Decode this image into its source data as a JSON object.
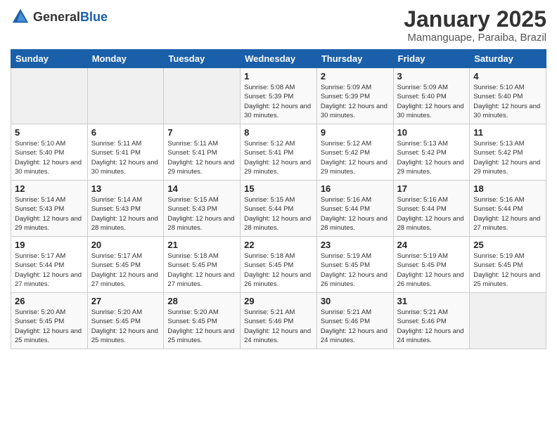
{
  "logo": {
    "general": "General",
    "blue": "Blue"
  },
  "title": {
    "month_year": "January 2025",
    "location": "Mamanguape, Paraiba, Brazil"
  },
  "days_of_week": [
    "Sunday",
    "Monday",
    "Tuesday",
    "Wednesday",
    "Thursday",
    "Friday",
    "Saturday"
  ],
  "weeks": [
    [
      {
        "num": "",
        "sunrise": "",
        "sunset": "",
        "daylight": ""
      },
      {
        "num": "",
        "sunrise": "",
        "sunset": "",
        "daylight": ""
      },
      {
        "num": "",
        "sunrise": "",
        "sunset": "",
        "daylight": ""
      },
      {
        "num": "1",
        "sunrise": "Sunrise: 5:08 AM",
        "sunset": "Sunset: 5:39 PM",
        "daylight": "Daylight: 12 hours and 30 minutes."
      },
      {
        "num": "2",
        "sunrise": "Sunrise: 5:09 AM",
        "sunset": "Sunset: 5:39 PM",
        "daylight": "Daylight: 12 hours and 30 minutes."
      },
      {
        "num": "3",
        "sunrise": "Sunrise: 5:09 AM",
        "sunset": "Sunset: 5:40 PM",
        "daylight": "Daylight: 12 hours and 30 minutes."
      },
      {
        "num": "4",
        "sunrise": "Sunrise: 5:10 AM",
        "sunset": "Sunset: 5:40 PM",
        "daylight": "Daylight: 12 hours and 30 minutes."
      }
    ],
    [
      {
        "num": "5",
        "sunrise": "Sunrise: 5:10 AM",
        "sunset": "Sunset: 5:40 PM",
        "daylight": "Daylight: 12 hours and 30 minutes."
      },
      {
        "num": "6",
        "sunrise": "Sunrise: 5:11 AM",
        "sunset": "Sunset: 5:41 PM",
        "daylight": "Daylight: 12 hours and 30 minutes."
      },
      {
        "num": "7",
        "sunrise": "Sunrise: 5:11 AM",
        "sunset": "Sunset: 5:41 PM",
        "daylight": "Daylight: 12 hours and 29 minutes."
      },
      {
        "num": "8",
        "sunrise": "Sunrise: 5:12 AM",
        "sunset": "Sunset: 5:41 PM",
        "daylight": "Daylight: 12 hours and 29 minutes."
      },
      {
        "num": "9",
        "sunrise": "Sunrise: 5:12 AM",
        "sunset": "Sunset: 5:42 PM",
        "daylight": "Daylight: 12 hours and 29 minutes."
      },
      {
        "num": "10",
        "sunrise": "Sunrise: 5:13 AM",
        "sunset": "Sunset: 5:42 PM",
        "daylight": "Daylight: 12 hours and 29 minutes."
      },
      {
        "num": "11",
        "sunrise": "Sunrise: 5:13 AM",
        "sunset": "Sunset: 5:42 PM",
        "daylight": "Daylight: 12 hours and 29 minutes."
      }
    ],
    [
      {
        "num": "12",
        "sunrise": "Sunrise: 5:14 AM",
        "sunset": "Sunset: 5:43 PM",
        "daylight": "Daylight: 12 hours and 29 minutes."
      },
      {
        "num": "13",
        "sunrise": "Sunrise: 5:14 AM",
        "sunset": "Sunset: 5:43 PM",
        "daylight": "Daylight: 12 hours and 28 minutes."
      },
      {
        "num": "14",
        "sunrise": "Sunrise: 5:15 AM",
        "sunset": "Sunset: 5:43 PM",
        "daylight": "Daylight: 12 hours and 28 minutes."
      },
      {
        "num": "15",
        "sunrise": "Sunrise: 5:15 AM",
        "sunset": "Sunset: 5:44 PM",
        "daylight": "Daylight: 12 hours and 28 minutes."
      },
      {
        "num": "16",
        "sunrise": "Sunrise: 5:16 AM",
        "sunset": "Sunset: 5:44 PM",
        "daylight": "Daylight: 12 hours and 28 minutes."
      },
      {
        "num": "17",
        "sunrise": "Sunrise: 5:16 AM",
        "sunset": "Sunset: 5:44 PM",
        "daylight": "Daylight: 12 hours and 28 minutes."
      },
      {
        "num": "18",
        "sunrise": "Sunrise: 5:16 AM",
        "sunset": "Sunset: 5:44 PM",
        "daylight": "Daylight: 12 hours and 27 minutes."
      }
    ],
    [
      {
        "num": "19",
        "sunrise": "Sunrise: 5:17 AM",
        "sunset": "Sunset: 5:44 PM",
        "daylight": "Daylight: 12 hours and 27 minutes."
      },
      {
        "num": "20",
        "sunrise": "Sunrise: 5:17 AM",
        "sunset": "Sunset: 5:45 PM",
        "daylight": "Daylight: 12 hours and 27 minutes."
      },
      {
        "num": "21",
        "sunrise": "Sunrise: 5:18 AM",
        "sunset": "Sunset: 5:45 PM",
        "daylight": "Daylight: 12 hours and 27 minutes."
      },
      {
        "num": "22",
        "sunrise": "Sunrise: 5:18 AM",
        "sunset": "Sunset: 5:45 PM",
        "daylight": "Daylight: 12 hours and 26 minutes."
      },
      {
        "num": "23",
        "sunrise": "Sunrise: 5:19 AM",
        "sunset": "Sunset: 5:45 PM",
        "daylight": "Daylight: 12 hours and 26 minutes."
      },
      {
        "num": "24",
        "sunrise": "Sunrise: 5:19 AM",
        "sunset": "Sunset: 5:45 PM",
        "daylight": "Daylight: 12 hours and 26 minutes."
      },
      {
        "num": "25",
        "sunrise": "Sunrise: 5:19 AM",
        "sunset": "Sunset: 5:45 PM",
        "daylight": "Daylight: 12 hours and 25 minutes."
      }
    ],
    [
      {
        "num": "26",
        "sunrise": "Sunrise: 5:20 AM",
        "sunset": "Sunset: 5:45 PM",
        "daylight": "Daylight: 12 hours and 25 minutes."
      },
      {
        "num": "27",
        "sunrise": "Sunrise: 5:20 AM",
        "sunset": "Sunset: 5:45 PM",
        "daylight": "Daylight: 12 hours and 25 minutes."
      },
      {
        "num": "28",
        "sunrise": "Sunrise: 5:20 AM",
        "sunset": "Sunset: 5:45 PM",
        "daylight": "Daylight: 12 hours and 25 minutes."
      },
      {
        "num": "29",
        "sunrise": "Sunrise: 5:21 AM",
        "sunset": "Sunset: 5:46 PM",
        "daylight": "Daylight: 12 hours and 24 minutes."
      },
      {
        "num": "30",
        "sunrise": "Sunrise: 5:21 AM",
        "sunset": "Sunset: 5:46 PM",
        "daylight": "Daylight: 12 hours and 24 minutes."
      },
      {
        "num": "31",
        "sunrise": "Sunrise: 5:21 AM",
        "sunset": "Sunset: 5:46 PM",
        "daylight": "Daylight: 12 hours and 24 minutes."
      },
      {
        "num": "",
        "sunrise": "",
        "sunset": "",
        "daylight": ""
      }
    ]
  ]
}
